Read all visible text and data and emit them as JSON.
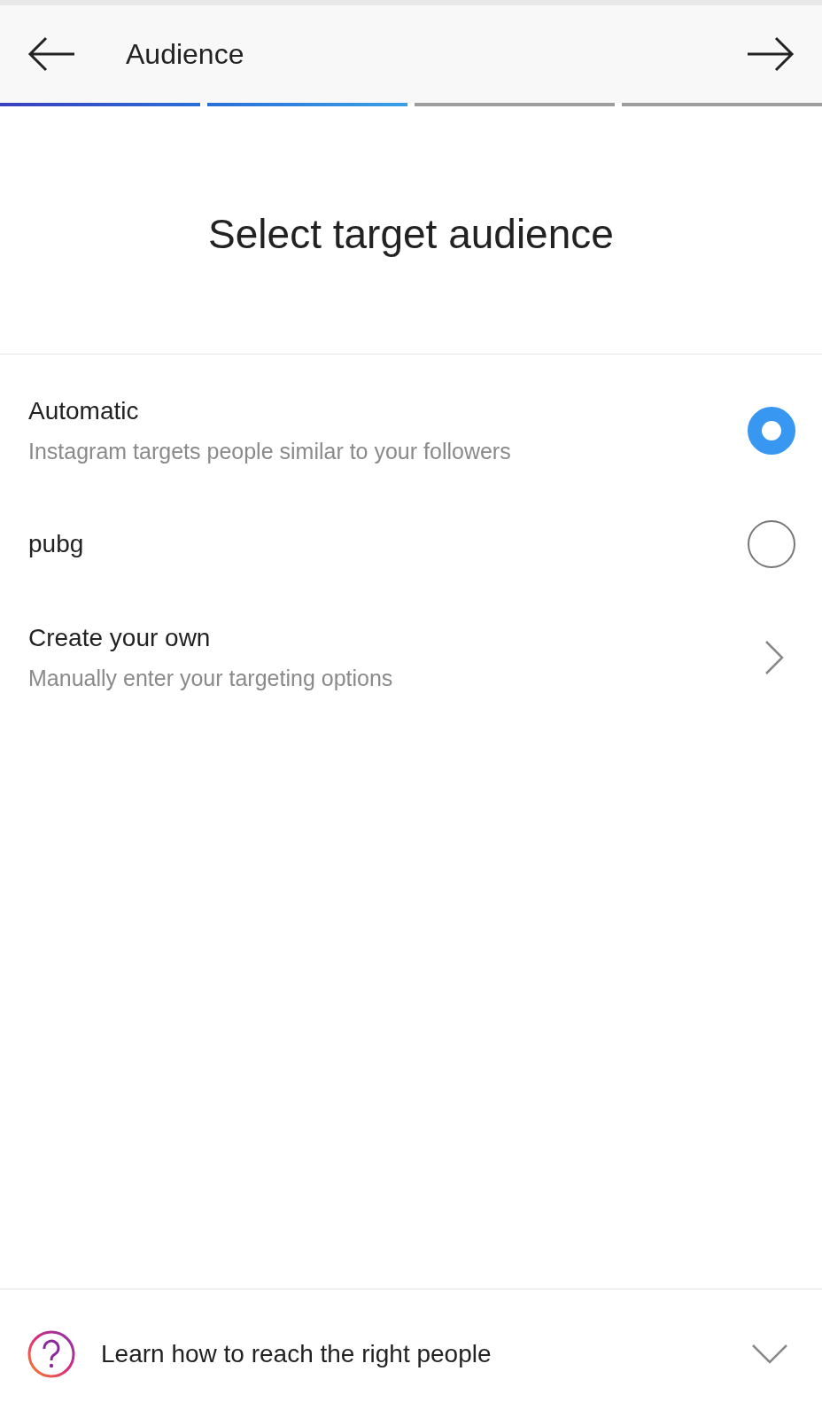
{
  "header": {
    "title": "Audience"
  },
  "progress": [
    {
      "completed": true
    },
    {
      "completed": true
    },
    {
      "completed": false
    },
    {
      "completed": false
    }
  ],
  "heading": "Select target audience",
  "options": [
    {
      "kind": "radio",
      "title": "Automatic",
      "subtitle": "Instagram targets people similar to your followers",
      "selected": true
    },
    {
      "kind": "radio",
      "title": "pubg",
      "selected": false
    },
    {
      "kind": "link",
      "title": "Create your own",
      "subtitle": "Manually enter your targeting options"
    }
  ],
  "footer": {
    "text": "Learn how to reach the right people"
  }
}
